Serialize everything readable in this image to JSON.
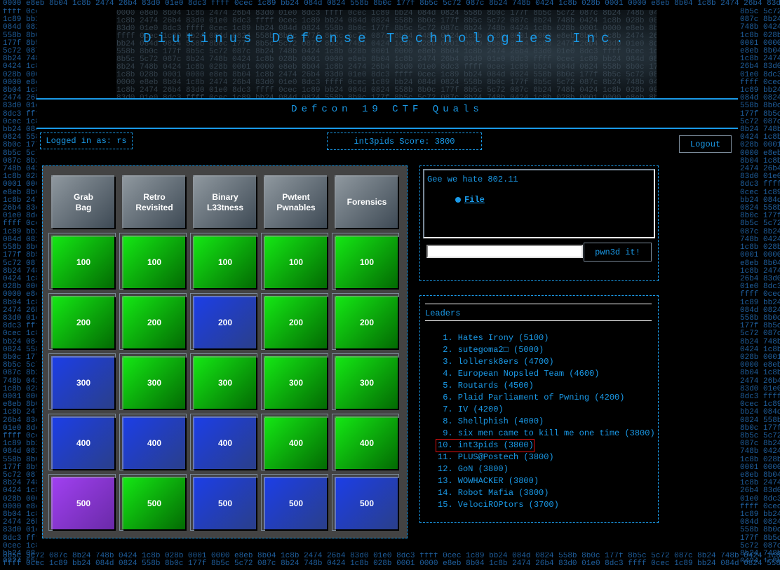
{
  "background_hex": [
    "ffff",
    "0cec",
    "1c89",
    "bb24",
    "084d",
    "0824",
    "558b",
    "8b0c",
    "177f",
    "8b5c",
    "5c72",
    "087c",
    "8b24",
    "748b",
    "0424",
    "1c8b",
    "028b",
    "0001",
    "0000",
    "e8eb",
    "8b04",
    "1c8b",
    "2474",
    "26b4",
    "83d0",
    "01e0",
    "8dc3"
  ],
  "header": {
    "title": "Diutinus Defense Technologies Inc.",
    "subtitle": "Defcon 19 CTF Quals"
  },
  "status": {
    "logged_in": "Logged in as: rs",
    "score": "int3pids Score: 3800",
    "logout": "Logout"
  },
  "board": {
    "categories": [
      "Grab\nBag",
      "Retro\nRevisited",
      "Binary\nL33tness",
      "Pwtent\nPwnables",
      "Forensics"
    ],
    "rows": [
      {
        "value": "100",
        "states": [
          "green",
          "green",
          "green",
          "green",
          "green"
        ]
      },
      {
        "value": "200",
        "states": [
          "green",
          "green",
          "blue",
          "green",
          "green"
        ]
      },
      {
        "value": "300",
        "states": [
          "blue",
          "green",
          "green",
          "green",
          "green"
        ]
      },
      {
        "value": "400",
        "states": [
          "blue",
          "blue",
          "blue",
          "green",
          "green"
        ]
      },
      {
        "value": "500",
        "states": [
          "purple",
          "green",
          "blue",
          "blue",
          "blue"
        ]
      }
    ]
  },
  "challenge": {
    "text": "Gee we hate 802.11",
    "file_link": "File",
    "answer_value": "",
    "submit": "pwn3d it!"
  },
  "leaders": {
    "title": "Leaders",
    "highlight_rank": 10,
    "entries": [
      " 1. Hates Irony (5100)",
      " 2. sutegoma2□ (5000)",
      " 3. lollersk8ers (4700)",
      " 4. European Nopsled Team (4600)",
      " 5. Routards (4500)",
      " 6. Plaid Parliament of Pwning (4200)",
      " 7. IV (4200)",
      " 8. Shellphish (4000)",
      " 9. six men came to kill me one time (3800)",
      "10. int3pids (3800)",
      "11. PLUS@Postech (3800)",
      "12. GoN (3800)",
      "13. WOWHACKER (3800)",
      "14. Robot Mafia (3800)",
      "15. VelociROPtors (3700)"
    ]
  }
}
